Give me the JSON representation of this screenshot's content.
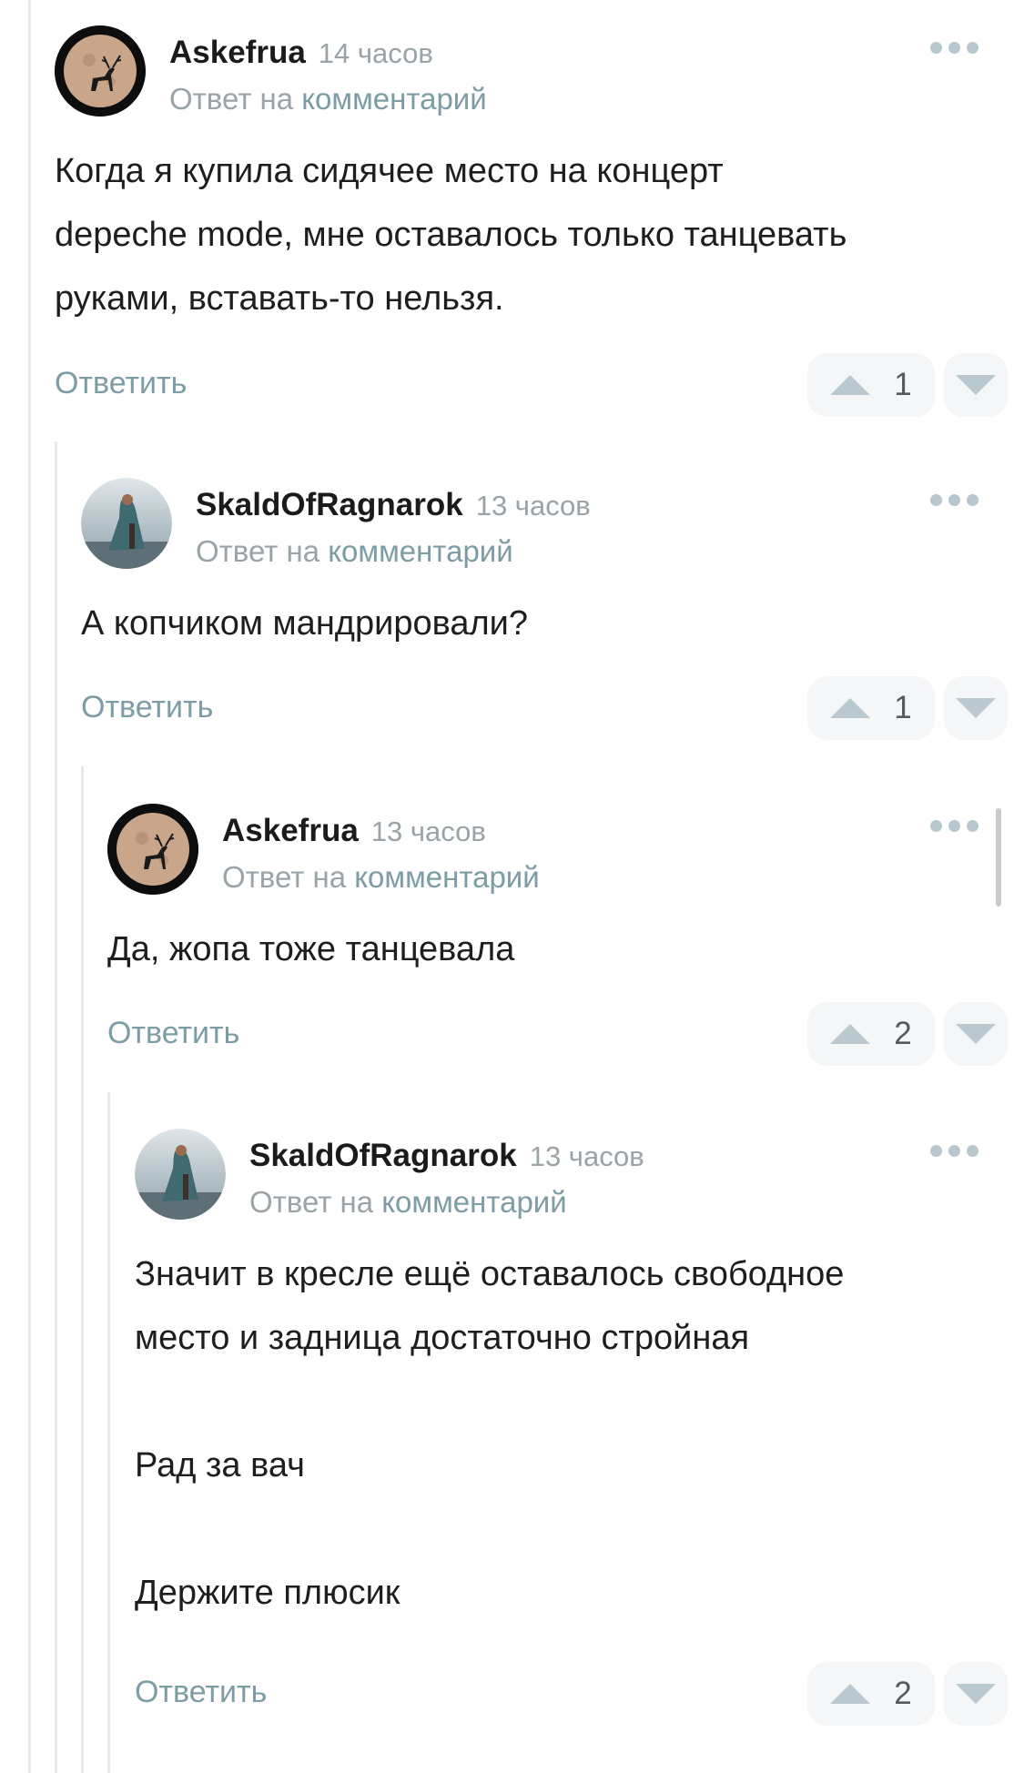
{
  "reply_link_label": "Ответить",
  "comments": [
    {
      "username": "Askefrua",
      "time": "14 часов",
      "reply_to_prefix": "Ответ на",
      "reply_to_link": "комментарий",
      "avatar": "deer-moon-avatar",
      "body": [
        "Когда я купила сидячее место на концерт",
        "depeche mode, мне оставалось только танцевать",
        "руками, вставать-то нельзя."
      ],
      "votes": "1"
    },
    {
      "username": "SkaldOfRagnarok",
      "time": "13 часов",
      "reply_to_prefix": "Ответ на",
      "reply_to_link": "комментарий",
      "avatar": "cloaked-warrior-avatar",
      "body": [
        "А копчиком мандрировали?"
      ],
      "votes": "1"
    },
    {
      "username": "Askefrua",
      "time": "13 часов",
      "reply_to_prefix": "Ответ на",
      "reply_to_link": "комментарий",
      "avatar": "deer-moon-avatar",
      "body": [
        "Да, жопа тоже танцевала"
      ],
      "votes": "2"
    },
    {
      "username": "SkaldOfRagnarok",
      "time": "13 часов",
      "reply_to_prefix": "Ответ на",
      "reply_to_link": "комментарий",
      "avatar": "cloaked-warrior-avatar",
      "body": [
        "Значит в кресле ещё оставалось свободное",
        "место и задница достаточно стройная",
        "",
        "Рад за вач",
        "",
        "Держите плюсик"
      ],
      "votes": "2"
    }
  ],
  "colors": {
    "accent": "#7c9ca6",
    "muted": "#9aa3a8",
    "vote_bg": "#f4f6f7",
    "thread_line": "#e6e9eb"
  }
}
